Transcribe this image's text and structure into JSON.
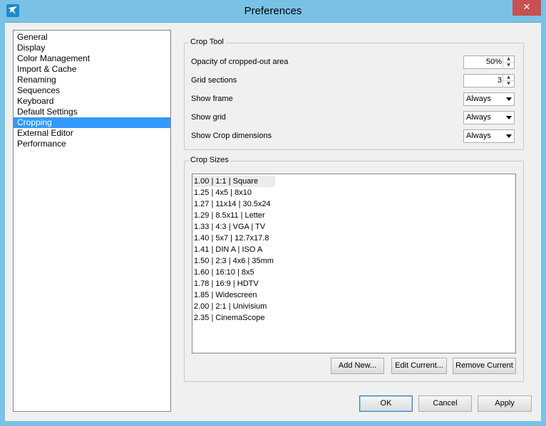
{
  "window": {
    "title": "Preferences",
    "close_label": "✕"
  },
  "nav": {
    "items": [
      {
        "label": "General"
      },
      {
        "label": "Display"
      },
      {
        "label": "Color Management"
      },
      {
        "label": "Import & Cache"
      },
      {
        "label": "Renaming"
      },
      {
        "label": "Sequences"
      },
      {
        "label": "Keyboard"
      },
      {
        "label": "Default Settings"
      },
      {
        "label": "Cropping"
      },
      {
        "label": "External Editor"
      },
      {
        "label": "Performance"
      }
    ],
    "selected": "Cropping"
  },
  "crop_tool": {
    "title": "Crop Tool",
    "opacity_label": "Opacity of cropped-out area",
    "opacity_value": "50%",
    "grid_sections_label": "Grid sections",
    "grid_sections_value": "3",
    "show_frame_label": "Show frame",
    "show_frame_value": "Always",
    "show_grid_label": "Show grid",
    "show_grid_value": "Always",
    "show_dims_label": "Show Crop dimensions",
    "show_dims_value": "Always"
  },
  "crop_sizes": {
    "title": "Crop Sizes",
    "items": [
      "1.00 | 1:1 | Square",
      "1.25 | 4x5 | 8x10",
      "1.27 | 11x14 | 30.5x24",
      "1.29 | 8.5x11 | Letter",
      "1.33 | 4:3 | VGA | TV",
      "1.40 | 5x7 | 12.7x17.8",
      "1.41 | DIN A | ISO A",
      "1.50 | 2:3 | 4x6 | 35mm",
      "1.60 | 16:10 | 8x5",
      "1.78 | 16:9 | HDTV",
      "1.85 | Widescreen",
      "2.00 | 2:1 | Univisium",
      "2.35 | CinemaScope"
    ],
    "add_label": "Add New...",
    "edit_label": "Edit Current...",
    "remove_label": "Remove Current"
  },
  "footer": {
    "ok_label": "OK",
    "cancel_label": "Cancel",
    "apply_label": "Apply"
  },
  "icons": {
    "app": "app-bird-icon",
    "close": "close-icon",
    "up": "spin-up-icon",
    "down": "spin-down-icon",
    "dropdown": "chevron-down-icon"
  },
  "colors": {
    "titlebar": "#79c2e5",
    "selection": "#3399ff",
    "close": "#c75050"
  }
}
